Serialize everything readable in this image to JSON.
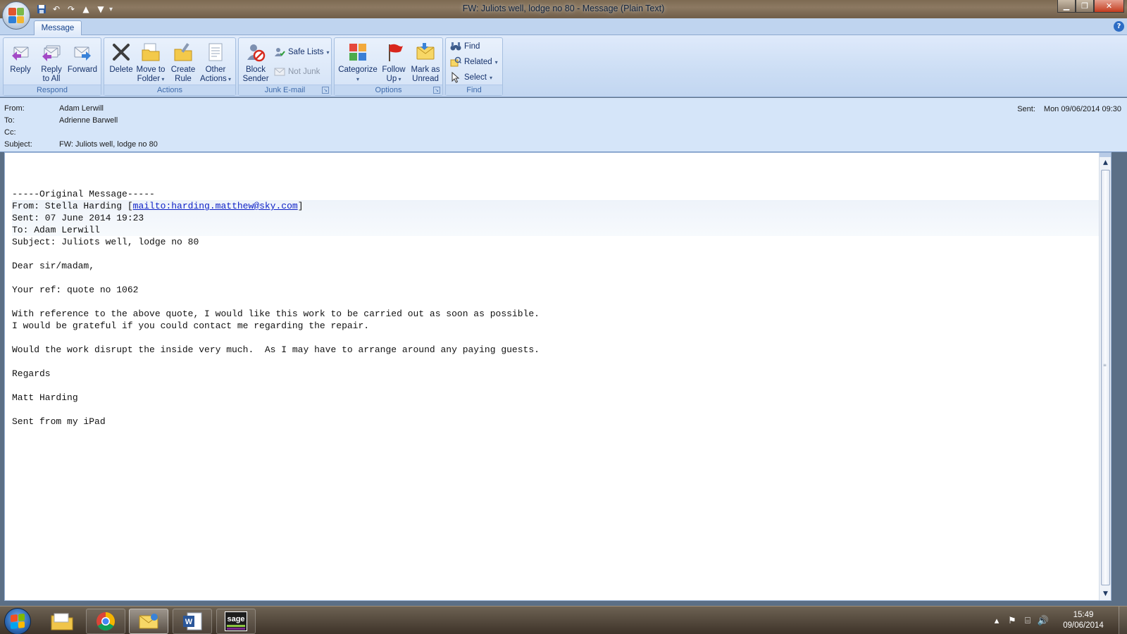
{
  "window": {
    "title": "FW: Juliots well, lodge no 80 - Message (Plain Text)"
  },
  "ribbon": {
    "tab": "Message",
    "groups": {
      "respond": {
        "label": "Respond",
        "reply": "Reply",
        "reply_all": "Reply\nto All",
        "forward": "Forward"
      },
      "actions": {
        "label": "Actions",
        "delete": "Delete",
        "move_to_folder": "Move to\nFolder",
        "create_rule": "Create\nRule",
        "other_actions": "Other\nActions"
      },
      "junk": {
        "label": "Junk E-mail",
        "block_sender": "Block\nSender",
        "safe_lists": "Safe Lists",
        "not_junk": "Not Junk"
      },
      "options": {
        "label": "Options",
        "categorize": "Categorize",
        "follow_up": "Follow\nUp",
        "mark_unread": "Mark as\nUnread"
      },
      "find": {
        "label": "Find",
        "find": "Find",
        "related": "Related",
        "select": "Select"
      }
    }
  },
  "header": {
    "from_label": "From:",
    "from": "Adam Lerwill",
    "to_label": "To:",
    "to": "Adrienne Barwell",
    "cc_label": "Cc:",
    "cc": "",
    "subject_label": "Subject:",
    "subject": "FW: Juliots well, lodge no 80",
    "sent_label": "Sent:",
    "sent": "Mon 09/06/2014 09:30"
  },
  "body": {
    "original_marker": "-----Original Message-----",
    "from_prefix": "From: Stella Harding [",
    "mailto": "mailto:harding.matthew@sky.com",
    "from_suffix": "]",
    "sent_line": "Sent: 07 June 2014 19:23",
    "to_line": "To: Adam Lerwill",
    "subject_line": "Subject: Juliots well, lodge no 80",
    "greeting": "Dear sir/madam,",
    "ref": "Your ref: quote no 1062",
    "para1_line1": "With reference to the above quote, I would like this work to be carried out as soon as possible.",
    "para1_line2": "I would be grateful if you could contact me regarding the repair.",
    "para2": "Would the work disrupt the inside very much.  As I may have to arrange around any paying guests.",
    "regards": "Regards",
    "signature": "Matt Harding",
    "footer": "Sent from my iPad"
  },
  "taskbar": {
    "time": "15:49",
    "date": "09/06/2014",
    "sage_label": "sage"
  },
  "colors": {
    "ribbon_text": "#15316b",
    "group_label": "#3e6aaa",
    "link": "#0b1fc6"
  }
}
